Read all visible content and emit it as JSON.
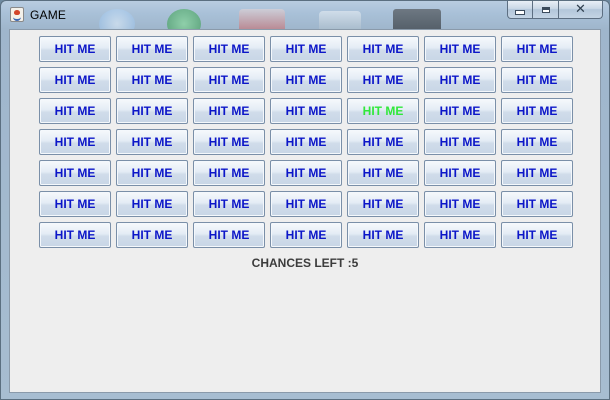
{
  "window": {
    "title": "GAME",
    "app_icon": "java-cup-icon",
    "controls": {
      "minimize": "minimize-icon",
      "maximize": "maximize-icon",
      "close": "✕"
    }
  },
  "grid": {
    "rows": [
      [
        "HIT ME",
        "HIT ME",
        "HIT ME",
        "HIT ME",
        "HIT ME",
        "HIT ME",
        "HIT ME"
      ],
      [
        "HIT ME",
        "HIT ME",
        "HIT ME",
        "HIT ME",
        "HIT ME",
        "HIT ME",
        "HIT ME"
      ],
      [
        "HIT ME",
        "HIT ME",
        "HIT ME",
        "HIT ME",
        "HIT ME",
        "HIT ME",
        "HIT ME"
      ],
      [
        "HIT ME",
        "HIT ME",
        "HIT ME",
        "HIT ME",
        "HIT ME",
        "HIT ME",
        "HIT ME"
      ],
      [
        "HIT ME",
        "HIT ME",
        "HIT ME",
        "HIT ME",
        "HIT ME",
        "HIT ME",
        "HIT ME"
      ],
      [
        "HIT ME",
        "HIT ME",
        "HIT ME",
        "HIT ME",
        "HIT ME",
        "HIT ME",
        "HIT ME"
      ],
      [
        "HIT ME",
        "HIT ME",
        "HIT ME",
        "HIT ME",
        "HIT ME",
        "HIT ME",
        "HIT ME"
      ]
    ],
    "highlighted": {
      "row": 3,
      "col": 5,
      "color": "#30e83a"
    },
    "button_text_color": "#0c16c8"
  },
  "status": {
    "chances_text": "CHANCES LEFT :5"
  }
}
